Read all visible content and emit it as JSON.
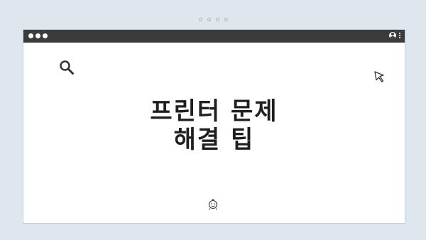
{
  "window": {
    "title_lines": [
      "프린터 문제",
      "해결 팁"
    ]
  },
  "icons": {
    "search": "search-icon",
    "cursor": "cursor-icon",
    "user": "user-icon",
    "menu": "kebab-menu-icon",
    "face": "smiley-face-icon"
  },
  "colors": {
    "background": "#dfe6ee",
    "titlebar": "#3b3b3b",
    "window": "#ffffff",
    "text": "#1f1f1f"
  }
}
